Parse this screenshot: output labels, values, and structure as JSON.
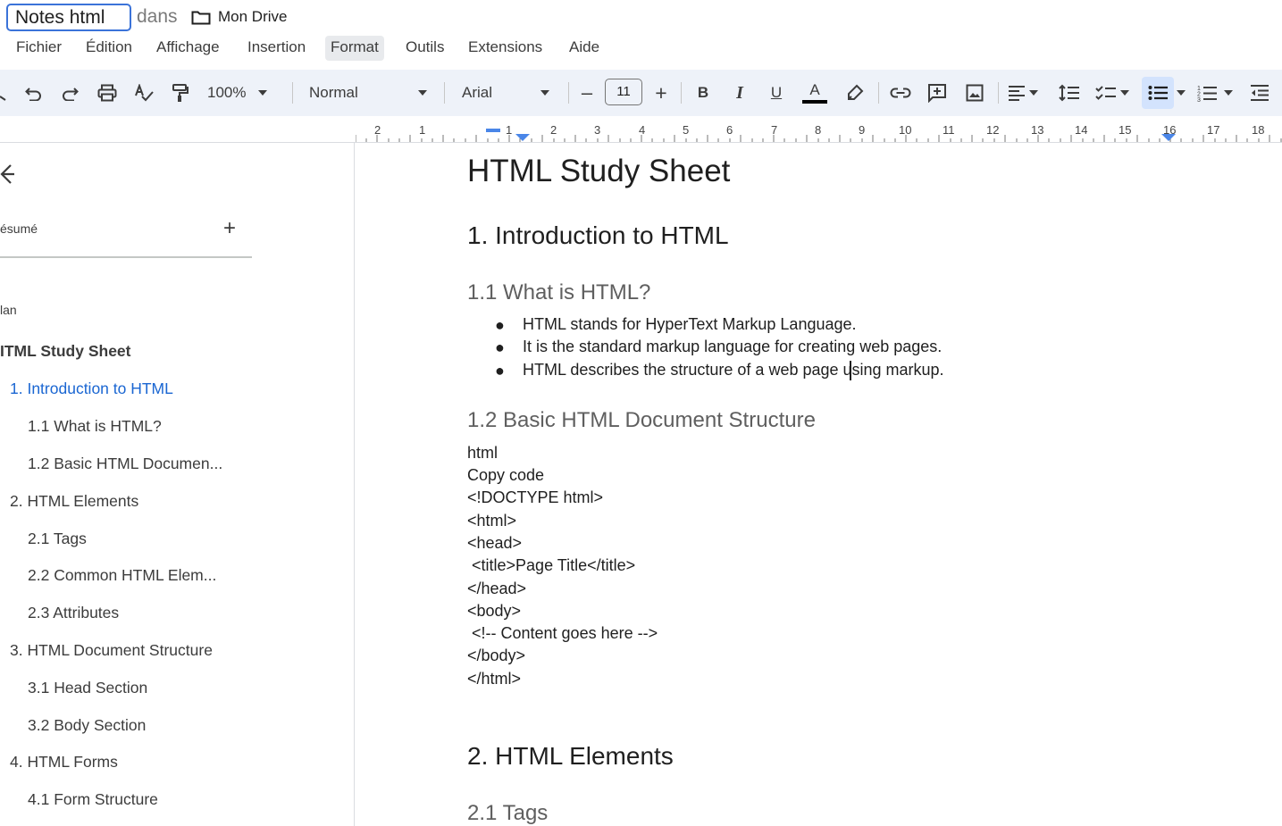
{
  "header": {
    "doc_title": "Notes html",
    "in_label": "dans",
    "folder_name": "Mon Drive"
  },
  "menu": [
    "Fichier",
    "Édition",
    "Affichage",
    "Insertion",
    "Format",
    "Outils",
    "Extensions",
    "Aide"
  ],
  "menu_active": "Format",
  "toolbar": {
    "zoom": "100%",
    "style": "Normal",
    "font": "Arial",
    "font_size": "11",
    "minus": "–",
    "plus": "+",
    "bold": "B",
    "italic": "I",
    "underline": "U",
    "text_color_glyph": "A",
    "text_color": "#000000",
    "active_tool": "bulleted-list",
    "icons": [
      "undo-icon",
      "redo-icon",
      "print-icon",
      "spellcheck-icon",
      "paint-format-icon",
      "highlighter-icon",
      "link-icon",
      "add-comment-icon",
      "insert-image-icon",
      "align-icon",
      "line-spacing-icon",
      "checklist-icon",
      "bulleted-list-icon",
      "numbered-list-icon",
      "indent-icon"
    ]
  },
  "ruler": {
    "numbers": [
      "2",
      "1",
      "1",
      "2",
      "3",
      "4",
      "5",
      "6",
      "7",
      "8",
      "9",
      "10",
      "11",
      "12",
      "13",
      "14",
      "15",
      "16",
      "17",
      "18"
    ]
  },
  "sidebar": {
    "summary_label": "ésumé",
    "add_glyph": "+",
    "outline_label": "lan",
    "outline": [
      {
        "label": "ITML Study Sheet",
        "level": 0
      },
      {
        "label": "1. Introduction to HTML",
        "level": 1,
        "current": true
      },
      {
        "label": "1.1 What is HTML?",
        "level": 2
      },
      {
        "label": "1.2 Basic HTML Documen...",
        "level": 2
      },
      {
        "label": "2. HTML Elements",
        "level": 1
      },
      {
        "label": "2.1 Tags",
        "level": 2
      },
      {
        "label": "2.2 Common HTML Elem...",
        "level": 2
      },
      {
        "label": "2.3 Attributes",
        "level": 2
      },
      {
        "label": "3. HTML Document Structure",
        "level": 1
      },
      {
        "label": "3.1 Head Section",
        "level": 2
      },
      {
        "label": "3.2 Body Section",
        "level": 2
      },
      {
        "label": "4. HTML Forms",
        "level": 1
      },
      {
        "label": "4.1 Form Structure",
        "level": 2
      }
    ]
  },
  "document": {
    "title": "HTML Study Sheet",
    "h1_intro": "1. Introduction to HTML",
    "h2_what": "1.1 What is HTML?",
    "bullets": [
      "HTML stands for HyperText Markup Language.",
      "It is the standard markup language for creating web pages.",
      "HTML describes the structure of a web page using markup."
    ],
    "bullet_glyph": "●",
    "h2_structure": "1.2 Basic HTML Document Structure",
    "code_lines": [
      "html",
      "Copy code",
      "<!DOCTYPE html>",
      "<html>",
      "<head>",
      " <title>Page Title</title>",
      "</head>",
      "<body>",
      " <!-- Content goes here -->",
      "</body>",
      "</html>"
    ],
    "h1_elements": "2. HTML Elements",
    "h2_tags": "2.1 Tags"
  }
}
